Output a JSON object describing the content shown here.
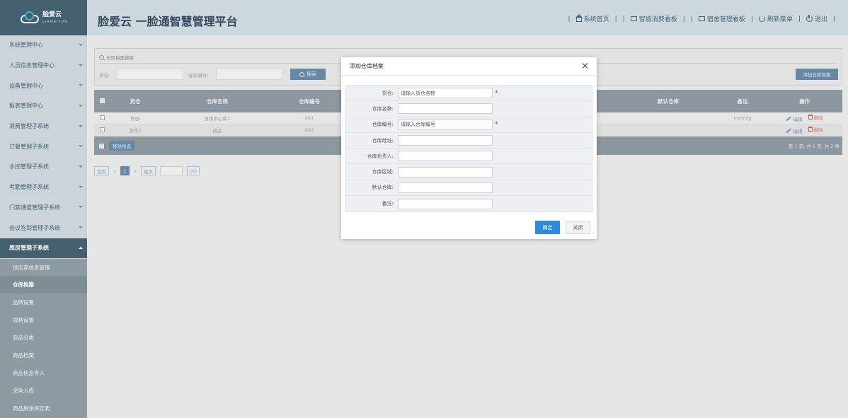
{
  "header": {
    "logo_text": "脸爱云",
    "logo_sub": "LIANAIYUN",
    "title": "脸爱云 一脸通智慧管理平台",
    "nav": {
      "home": "系统首页",
      "consume_board": "智能消费看板",
      "dorm_board": "宿舍管理看板",
      "refresh": "刷新菜单",
      "logout": "退出"
    }
  },
  "sidebar": {
    "items": [
      {
        "label": "系统管理中心"
      },
      {
        "label": "人员信息管理中心"
      },
      {
        "label": "设备管理中心"
      },
      {
        "label": "报表管理中心"
      },
      {
        "label": "消费管理子系统"
      },
      {
        "label": "订餐管理子系统"
      },
      {
        "label": "水控管理子系统"
      },
      {
        "label": "考勤管理子系统"
      },
      {
        "label": "门禁通道管理子系统"
      },
      {
        "label": "会议签到管理子系统"
      },
      {
        "label": "库房管理子系统"
      }
    ],
    "sub_items": [
      {
        "label": "供应商信息管理"
      },
      {
        "label": "仓库档案"
      },
      {
        "label": "品牌设置"
      },
      {
        "label": "规格设置"
      },
      {
        "label": "商品分类"
      },
      {
        "label": "商品档案"
      },
      {
        "label": "商品信息导入"
      },
      {
        "label": "采购入库"
      },
      {
        "label": "商品剩余库存表"
      }
    ]
  },
  "search": {
    "title": "仓库档案搜索",
    "label_company": "货仓:",
    "label_code": "仓库编号:",
    "search_button": "搜索",
    "add_button": "添加仓库档案"
  },
  "grid": {
    "columns": [
      "货仓",
      "仓库名称",
      "仓库编号",
      "默认仓库",
      "备注",
      "操作"
    ],
    "rows": [
      {
        "company": "货仓I",
        "name": "分拣中心库1",
        "code": "001",
        "default": "",
        "remark": "nothing"
      },
      {
        "company": "货仓2",
        "name": "成品",
        "code": "002",
        "default": "",
        "remark": ""
      }
    ],
    "edit_label": "编辑",
    "delete_label": "删除",
    "remove_selected": "移除所选",
    "page_summary": "第 1 页, 共 1 页, 共 2 条"
  },
  "pager": {
    "first": "首页",
    "prev": "«",
    "current": "1",
    "next": "»",
    "last": "尾页",
    "go": "GO"
  },
  "modal": {
    "title": "添加仓库档案",
    "fields": [
      {
        "label": "货仓:",
        "placeholder": "请输入货仓名称",
        "required": true
      },
      {
        "label": "仓库名称:",
        "placeholder": "",
        "required": false
      },
      {
        "label": "仓库编号:",
        "placeholder": "请输入仓库编号",
        "required": true
      },
      {
        "label": "仓库地址:",
        "placeholder": "",
        "required": false
      },
      {
        "label": "仓库负责人:",
        "placeholder": "",
        "required": false
      },
      {
        "label": "仓库区域:",
        "placeholder": "",
        "required": false
      },
      {
        "label": "默认仓库:",
        "placeholder": "",
        "required": false
      },
      {
        "label": "备注:",
        "placeholder": "",
        "required": false
      }
    ],
    "required_mark": "*",
    "ok_button": "确定",
    "close_button": "关闭"
  },
  "colors": {
    "header_bg": "#cdd8de",
    "sidebar_active": "#44606f",
    "primary_button": "#2f8ad8",
    "required": "#e03030"
  }
}
